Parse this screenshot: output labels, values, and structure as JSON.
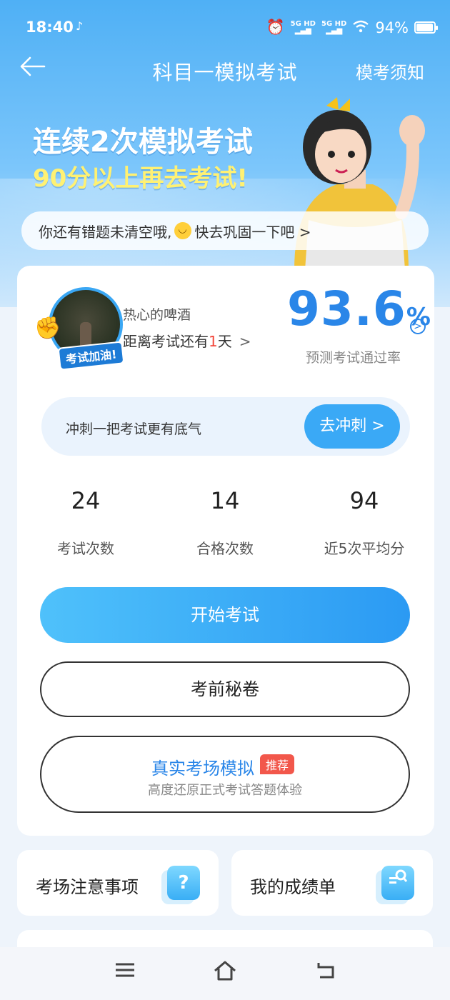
{
  "status_bar": {
    "time": "18:40",
    "music_icon": "music-note-icon",
    "network_1": "5G HD",
    "network_2": "5G HD",
    "battery": "94%"
  },
  "nav": {
    "title": "科目一模拟考试",
    "right_link": "模考须知",
    "back_icon": "back-arrow-icon"
  },
  "banner": {
    "line1": "连续2次模拟考试",
    "line2": "90分以上再去考试!"
  },
  "notice": {
    "text_before": "你还有错题未清空哦,",
    "text_after": "快去巩固一下吧 >"
  },
  "profile": {
    "badge": "考试加油!",
    "name": "热心的啤酒",
    "countdown_prefix": "距离考试还有",
    "countdown_days": "1",
    "countdown_suffix": "天"
  },
  "pass_rate": {
    "value": "93.6",
    "unit": "%",
    "label": "预测考试通过率"
  },
  "sprint": {
    "text": "冲刺一把考试更有底气",
    "button": "去冲刺 >"
  },
  "stats": [
    {
      "value": "24",
      "label": "考试次数"
    },
    {
      "value": "14",
      "label": "合格次数"
    },
    {
      "value": "94",
      "label": "近5次平均分"
    }
  ],
  "buttons": {
    "start": "开始考试",
    "secret": "考前秘卷",
    "simulation_title": "真实考场模拟",
    "simulation_tag": "推荐",
    "simulation_sub": "高度还原正式考试答题体验"
  },
  "tiles": [
    {
      "label": "考场注意事项",
      "icon": "question-icon"
    },
    {
      "label": "我的成绩单",
      "icon": "report-search-icon"
    }
  ],
  "colors": {
    "accent": "#2a86e8",
    "button_blue": "#3aa9f6",
    "tag_red": "#f2574b",
    "highlight_yellow": "#fff173"
  }
}
